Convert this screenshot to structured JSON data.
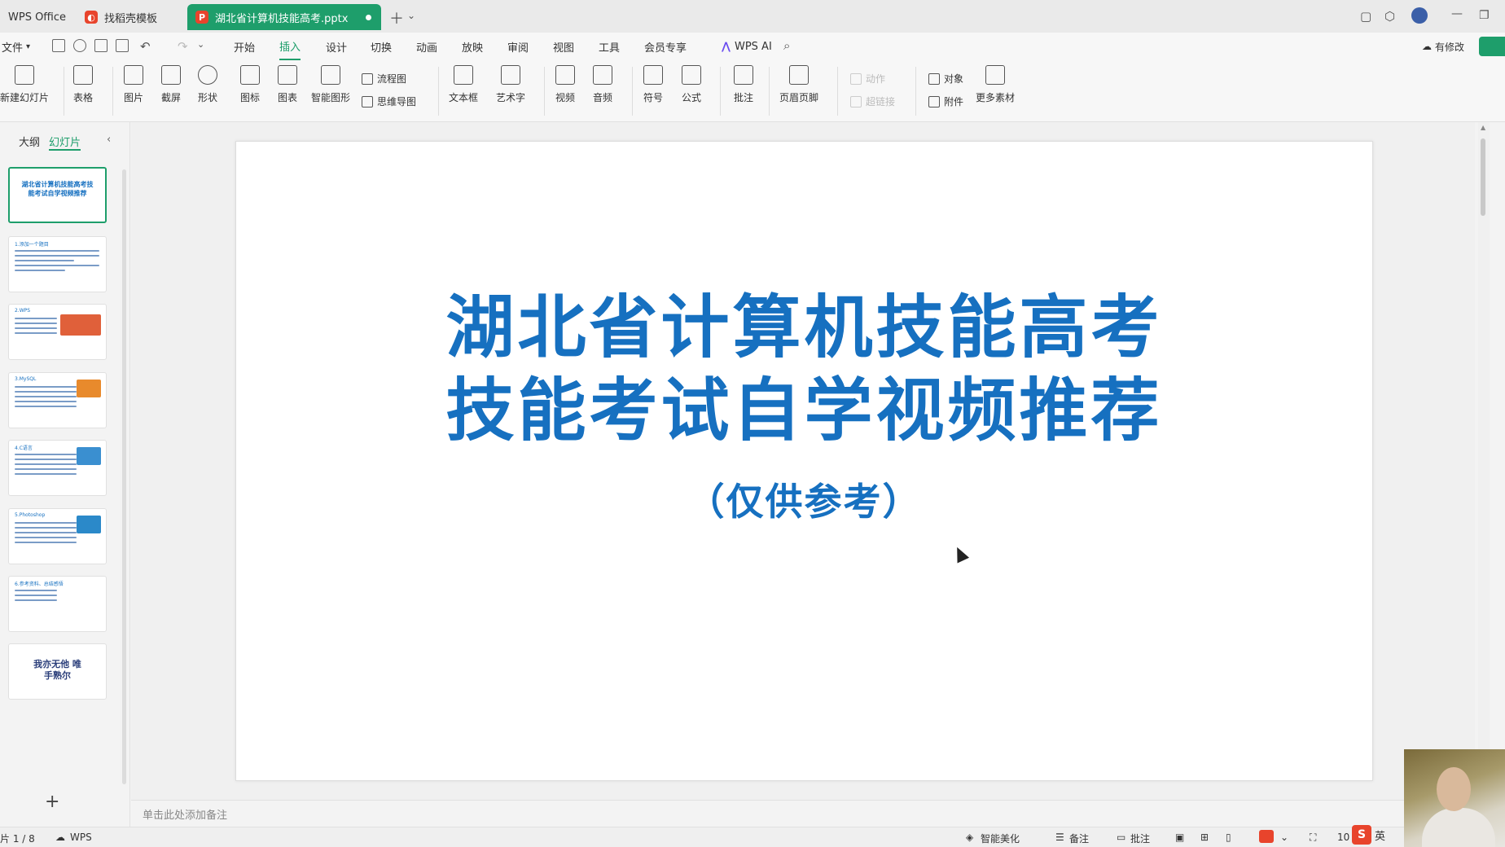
{
  "titlebar": {
    "tabs": [
      {
        "label": "WPS Office"
      },
      {
        "label": "找稻壳模板"
      },
      {
        "label": "湖北省计算机技能高考.pptx"
      }
    ],
    "new_tab_icon": "plus-icon"
  },
  "menu": {
    "file_label": "文件",
    "items": [
      "开始",
      "插入",
      "设计",
      "切换",
      "动画",
      "放映",
      "审阅",
      "视图",
      "工具",
      "会员专享"
    ],
    "active": "插入",
    "wps_ai": "WPS AI",
    "modified_label": "有修改"
  },
  "ribbon": {
    "new_slide": "新建幻灯片",
    "table": "表格",
    "picture": "图片",
    "screenshot": "截屏",
    "shape": "形状",
    "icon": "图标",
    "chart": "图表",
    "smart_shape": "智能图形",
    "flowchart": "流程图",
    "mindmap": "思维导图",
    "textbox": "文本框",
    "wordart": "艺术字",
    "video": "视频",
    "audio": "音频",
    "symbol": "符号",
    "formula": "公式",
    "comment": "批注",
    "header_footer": "页眉页脚",
    "action": "动作",
    "hyperlink": "超链接",
    "object": "对象",
    "attachment": "附件",
    "more_material": "更多素材"
  },
  "left_panel": {
    "tab_outline": "大纲",
    "tab_slides": "幻灯片",
    "thumbnails": [
      {
        "text": "湖北省计算机技能高考技能考试自学视频推荐"
      },
      {
        "text": "1.添加一个题目"
      },
      {
        "text": "2.WPS"
      },
      {
        "text": "3.MySQL"
      },
      {
        "text": "4.C语言"
      },
      {
        "text": "5.Photoshop"
      },
      {
        "text": "6.参考资料、总结感悟"
      },
      {
        "text": "我亦无他 唯手熟尔"
      }
    ],
    "add_slide_icon": "plus-icon"
  },
  "slide": {
    "title_line1": "湖北省计算机技能高考",
    "title_line2": "技能考试自学视频推荐",
    "subtitle": "（仅供参考）"
  },
  "notes": {
    "placeholder": "单击此处添加备注"
  },
  "status": {
    "page": "片 1 / 8",
    "wps_label": "WPS",
    "smart_beautify": "智能美化",
    "notes_label": "备注",
    "comment_label": "批注",
    "zoom": "10",
    "ime_lang": "英"
  },
  "colors": {
    "accent": "#1e9e6b",
    "title_blue": "#1670c0"
  }
}
